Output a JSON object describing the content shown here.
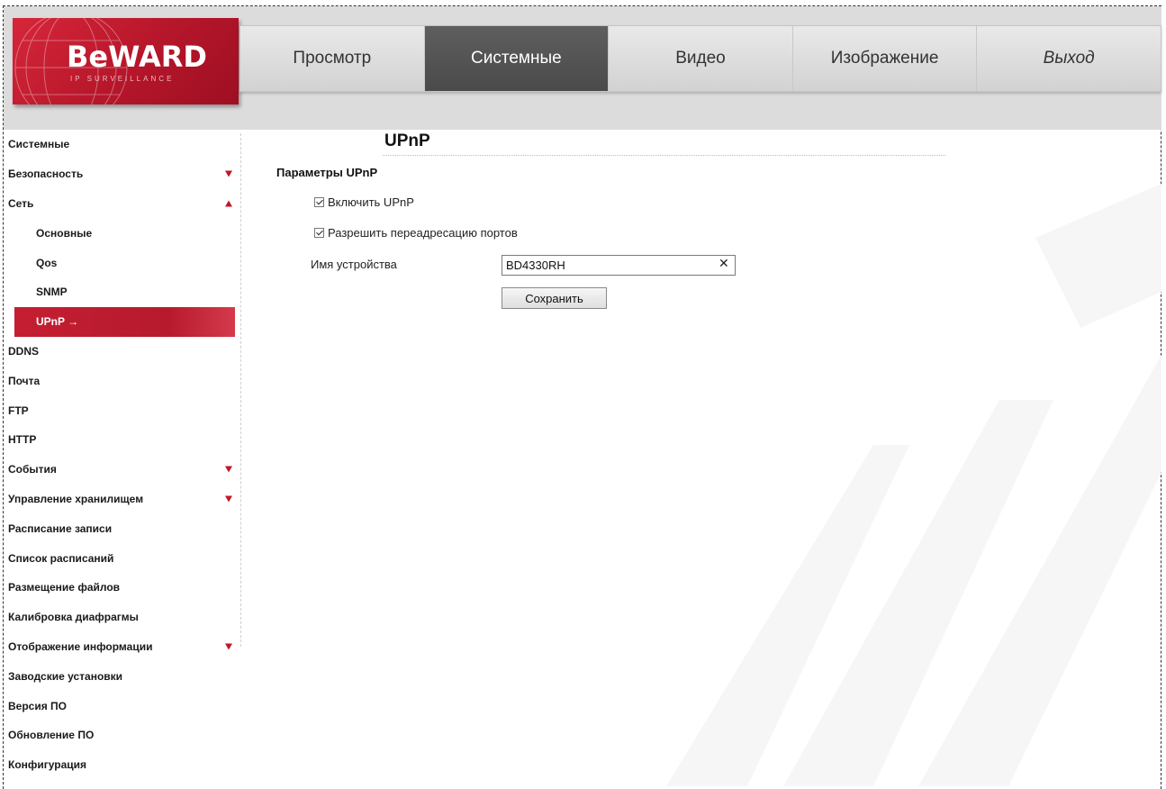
{
  "brand": {
    "logo_text": "BeWARD",
    "logo_sub": "IP SURVEILLANCE"
  },
  "nav": {
    "items": [
      {
        "label": "Просмотр"
      },
      {
        "label": "Системные"
      },
      {
        "label": "Видео"
      },
      {
        "label": "Изображение"
      },
      {
        "label": "Выход"
      }
    ],
    "active": "Системные"
  },
  "sidebar": {
    "items": [
      {
        "label": "Системные"
      },
      {
        "label": "Безопасность",
        "expand": "down"
      },
      {
        "label": "Сеть",
        "expand": "up"
      },
      {
        "label": "Основные",
        "sub": true
      },
      {
        "label": "Qos",
        "sub": true
      },
      {
        "label": "SNMP",
        "sub": true
      },
      {
        "label": "UPnP →",
        "sub": true,
        "active": true
      },
      {
        "label": "DDNS"
      },
      {
        "label": "Почта"
      },
      {
        "label": "FTP"
      },
      {
        "label": "HTTP"
      },
      {
        "label": "События",
        "expand": "down"
      },
      {
        "label": "Управление хранилищем",
        "expand": "down"
      },
      {
        "label": "Расписание записи"
      },
      {
        "label": "Список расписаний"
      },
      {
        "label": "Размещение файлов"
      },
      {
        "label": "Калибровка диафрагмы"
      },
      {
        "label": "Отображение информации",
        "expand": "down"
      },
      {
        "label": "Заводские установки"
      },
      {
        "label": "Версия ПО"
      },
      {
        "label": "Обновление ПО"
      },
      {
        "label": "Конфигурация"
      }
    ]
  },
  "main": {
    "title": "UPnP",
    "section": "Параметры UPnP",
    "enable_upnp": {
      "label": "Включить UPnP",
      "checked": true
    },
    "port_forward": {
      "label": "Разрешить переадресацию портов",
      "checked": true
    },
    "device_name": {
      "label": "Имя устройства",
      "value": "BD4330RH"
    },
    "save_label": "Сохранить"
  },
  "colors": {
    "accent": "#c41e32",
    "nav_active": "#505050",
    "header_bg": "#dcdcdc"
  }
}
